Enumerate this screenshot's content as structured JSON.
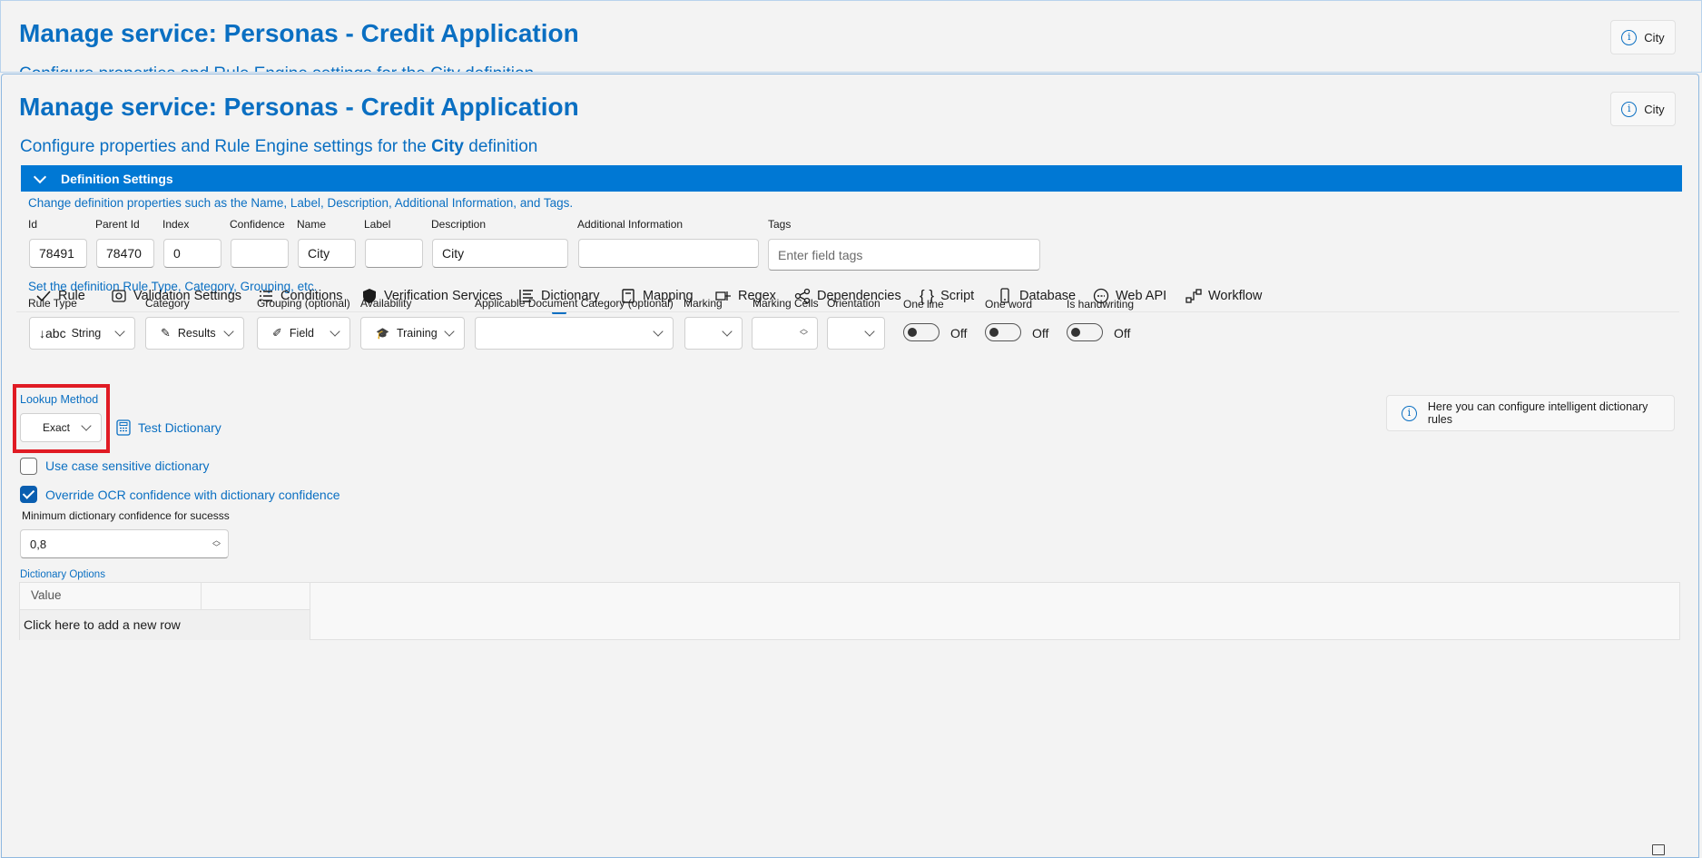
{
  "background_window": {
    "title": "Manage service: Personas - Credit Application",
    "subtitle_fragment": "Configure properties and Rule Engine settings for the City definition",
    "info_button": "City"
  },
  "window": {
    "title": "Manage service: Personas - Credit Application",
    "subtitle_prefix": "Configure properties and Rule Engine settings for the",
    "subtitle_bold": "City",
    "subtitle_suffix": "definition",
    "info_button": "City"
  },
  "definition_settings": {
    "header": "Definition Settings",
    "hint1": "Change definition properties such as the Name, Label, Description, Additional Information, and Tags.",
    "fields": {
      "id": {
        "label": "Id",
        "value": "78491"
      },
      "parent_id": {
        "label": "Parent Id",
        "value": "78470"
      },
      "index": {
        "label": "Index",
        "value": "0"
      },
      "confidence": {
        "label": "Confidence",
        "value": ""
      },
      "name": {
        "label": "Name",
        "value": "City"
      },
      "label": {
        "label": "Label",
        "value": ""
      },
      "description": {
        "label": "Description",
        "value": "City"
      },
      "additional_info": {
        "label": "Additional Information",
        "value": ""
      },
      "tags": {
        "label": "Tags",
        "placeholder": "Enter field tags"
      }
    },
    "hint2": "Set the definition Rule Type, Category, Grouping, etc.",
    "rule_type": {
      "label": "Rule Type",
      "value": "String",
      "icon": "abc"
    },
    "category": {
      "label": "Category",
      "value": "Results"
    },
    "grouping": {
      "label": "Grouping (optional)",
      "value": "Field"
    },
    "availability": {
      "label": "Availability",
      "value": "Training"
    },
    "doc_category": {
      "label": "Applicable Document Category (optional)",
      "value": ""
    },
    "marking": {
      "label": "Marking",
      "value": ""
    },
    "marking_cells": {
      "label": "Marking Cells",
      "value": ""
    },
    "orientation": {
      "label": "Orientation",
      "value": ""
    },
    "one_line": {
      "label": "One line",
      "state": "Off"
    },
    "one_word": {
      "label": "One word",
      "state": "Off"
    },
    "is_handwriting": {
      "label": "Is handwriting",
      "state": "Off"
    }
  },
  "tabs": [
    "Rule",
    "Validation Settings",
    "Conditions",
    "Verification Services",
    "Dictionary",
    "Mapping",
    "Regex",
    "Dependencies",
    "Script",
    "Database",
    "Web API",
    "Workflow"
  ],
  "active_tab": "Dictionary",
  "dictionary": {
    "lookup_method_label": "Lookup Method",
    "lookup_method_value": "Exact",
    "test_dictionary": "Test Dictionary",
    "case_sensitive": {
      "label": "Use case sensitive dictionary",
      "checked": false
    },
    "override_ocr": {
      "label": "Override OCR confidence with dictionary confidence",
      "checked": true
    },
    "min_conf_label": "Minimum dictionary confidence for sucesss",
    "min_conf_value": "0,8",
    "info_text": "Here you can configure intelligent dictionary rules",
    "options_label": "Dictionary Options",
    "grid_header": "Value",
    "add_row": "Click here to add a new row"
  },
  "colors": {
    "accent": "#0078d4",
    "link": "#0a6fc2",
    "highlight": "#e01b24"
  }
}
